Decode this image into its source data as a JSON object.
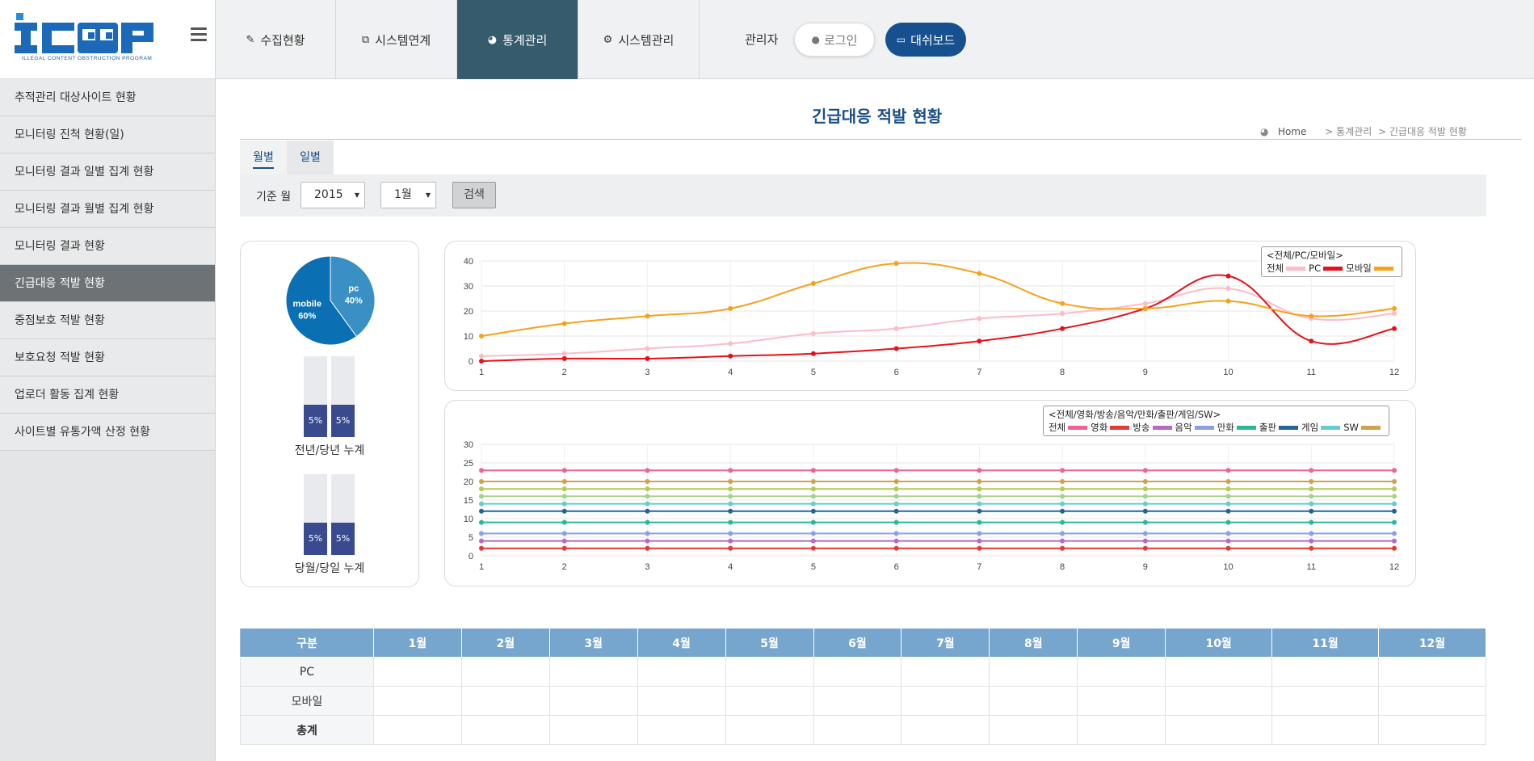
{
  "logo": {
    "text": "ICOP",
    "subtitle": "ILLEGAL CONTENT OBSTRUCTION PROGRAM"
  },
  "nav": {
    "tabs": [
      {
        "label": "수집현황",
        "icon": "edit-icon"
      },
      {
        "label": "시스템연계",
        "icon": "link-icon"
      },
      {
        "label": "통계관리",
        "icon": "pie-icon"
      },
      {
        "label": "시스템관리",
        "icon": "gears-icon"
      }
    ],
    "admin_label": "관리자",
    "login_label": "로그인",
    "dashboard_label": "대쉬보드"
  },
  "sidebar": {
    "items": [
      {
        "label": "추적관리 대상사이트 현황"
      },
      {
        "label": "모니터링 진척 현황(일)"
      },
      {
        "label": "모니터링 결과 일별 집계 현황"
      },
      {
        "label": "모니터링 결과 월별 집계 현황"
      },
      {
        "label": "모니터링 결과 현황"
      },
      {
        "label": "긴급대응 적발 현황"
      },
      {
        "label": "중점보호 적발 현황"
      },
      {
        "label": "보호요청 적발 현황"
      },
      {
        "label": "업로더 활동 집계 현황"
      },
      {
        "label": "사이트별 유통가액 산정 현황"
      }
    ]
  },
  "page": {
    "title": "긴급대응 적발 현황",
    "breadcrumb": {
      "home": "Home",
      "sep": ">",
      "level1": "통계관리",
      "level2": "긴급대응 적발 현황"
    },
    "tabs": [
      {
        "label": "월별"
      },
      {
        "label": "일별"
      }
    ]
  },
  "filter": {
    "label": "기준 월",
    "year": "2015",
    "month": "1월",
    "search_label": "검색"
  },
  "colors": {
    "accent": "#355b6d",
    "brand": "#17508f",
    "title": "#1a4f8a",
    "table_header": "#76a5cd",
    "bar_fill": "#394a8f",
    "pie_mobile": "#0b6fb4",
    "pie_pc": "#3a8fc4"
  },
  "pie": {
    "slices": [
      {
        "label": "mobile",
        "percent_text": "60%",
        "value": 60
      },
      {
        "label": "pc",
        "percent_text": "40%",
        "value": 40
      }
    ]
  },
  "bars": [
    {
      "caption": "전년/당년 누계",
      "values": [
        {
          "text": "5%",
          "fill": 0.4
        },
        {
          "text": "5%",
          "fill": 0.4
        }
      ]
    },
    {
      "caption": "당월/당일 누계",
      "values": [
        {
          "text": "5%",
          "fill": 0.4
        },
        {
          "text": "5%",
          "fill": 0.4
        }
      ]
    }
  ],
  "chart_data": [
    {
      "type": "line",
      "legend_title": "<전체/PC/모바일>",
      "x": [
        1,
        2,
        3,
        4,
        5,
        6,
        7,
        8,
        9,
        10,
        11,
        12
      ],
      "ylim": [
        0,
        40
      ],
      "yticks": [
        0,
        10,
        20,
        30,
        40
      ],
      "grid": true,
      "legend_position": "top-right",
      "series": [
        {
          "name": "전체",
          "color": "#fbbcc8",
          "values": [
            2,
            3,
            5,
            7,
            11,
            13,
            17,
            19,
            23,
            29,
            17,
            19
          ]
        },
        {
          "name": "PC",
          "color": "#e8101a",
          "values": [
            0,
            1,
            1,
            2,
            3,
            5,
            8,
            13,
            21,
            34,
            8,
            13
          ]
        },
        {
          "name": "모바일",
          "color": "#f5a21a",
          "values": [
            10,
            15,
            18,
            21,
            31,
            39,
            35,
            23,
            21,
            24,
            18,
            21
          ]
        }
      ]
    },
    {
      "type": "line",
      "legend_title": "<전체/영화/방송/음악/만화/출판/게임/SW>",
      "x": [
        1,
        2,
        3,
        4,
        5,
        6,
        7,
        8,
        9,
        10,
        11,
        12
      ],
      "ylim": [
        0,
        30
      ],
      "yticks": [
        0,
        5,
        10,
        15,
        20,
        25,
        30
      ],
      "grid": true,
      "legend_position": "top-right",
      "series": [
        {
          "name": "전체",
          "color": "#f06292",
          "values": [
            23,
            23,
            23,
            23,
            23,
            23,
            23,
            23,
            23,
            23,
            23,
            23
          ]
        },
        {
          "name": "영화",
          "color": "#e53935",
          "values": [
            2,
            2,
            2,
            2,
            2,
            2,
            2,
            2,
            2,
            2,
            2,
            2
          ]
        },
        {
          "name": "방송",
          "color": "#ba68c8",
          "values": [
            4,
            4,
            4,
            4,
            4,
            4,
            4,
            4,
            4,
            4,
            4,
            4
          ]
        },
        {
          "name": "음악",
          "color": "#8c9eea",
          "values": [
            6,
            6,
            6,
            6,
            6,
            6,
            6,
            6,
            6,
            6,
            6,
            6
          ]
        },
        {
          "name": "만화",
          "color": "#26b99a",
          "values": [
            9,
            9,
            9,
            9,
            9,
            9,
            9,
            9,
            9,
            9,
            9,
            9
          ]
        },
        {
          "name": "출판",
          "color": "#25639b",
          "values": [
            12,
            12,
            12,
            12,
            12,
            12,
            12,
            12,
            12,
            12,
            12,
            12
          ]
        },
        {
          "name": "게임",
          "color": "#66cccc",
          "values": [
            14,
            14,
            14,
            14,
            14,
            14,
            14,
            14,
            14,
            14,
            14,
            14
          ]
        },
        {
          "name": "SW",
          "color": "#d4a04a",
          "values": [
            20,
            20,
            20,
            20,
            20,
            20,
            20,
            20,
            20,
            20,
            20,
            20
          ]
        },
        {
          "name": "",
          "color": "#a8d08d",
          "values": [
            16,
            16,
            16,
            16,
            16,
            16,
            16,
            16,
            16,
            16,
            16,
            16
          ]
        },
        {
          "name": "",
          "color": "#b5c956",
          "values": [
            18,
            18,
            18,
            18,
            18,
            18,
            18,
            18,
            18,
            18,
            18,
            18
          ]
        }
      ]
    }
  ],
  "table": {
    "headers": [
      "구분",
      "1월",
      "2월",
      "3월",
      "4월",
      "5월",
      "6월",
      "7월",
      "8월",
      "9월",
      "10월",
      "11월",
      "12월"
    ],
    "rows": [
      {
        "label": "PC",
        "cells": [
          "",
          "",
          "",
          "",
          "",
          "",
          "",
          "",
          "",
          "",
          "",
          ""
        ]
      },
      {
        "label": "모바일",
        "cells": [
          "",
          "",
          "",
          "",
          "",
          "",
          "",
          "",
          "",
          "",
          "",
          ""
        ]
      },
      {
        "label": "총계",
        "cells": [
          "",
          "",
          "",
          "",
          "",
          "",
          "",
          "",
          "",
          "",
          "",
          ""
        ]
      }
    ]
  }
}
